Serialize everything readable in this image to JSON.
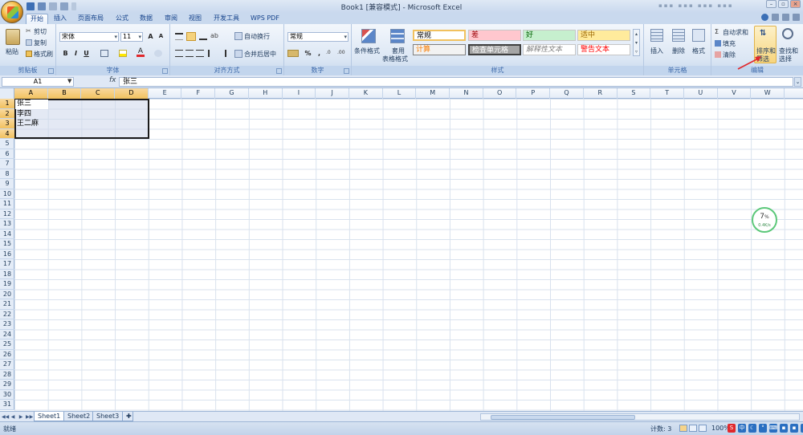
{
  "window": {
    "title": "Book1  [兼容模式] - Microsoft Excel"
  },
  "tabs": [
    "开始",
    "插入",
    "页面布局",
    "公式",
    "数据",
    "审阅",
    "视图",
    "开发工具",
    "WPS PDF"
  ],
  "ribbon": {
    "clipboard": {
      "paste": "粘贴",
      "cut": "剪切",
      "copy": "复制",
      "format_painter": "格式刷",
      "label": "剪贴板"
    },
    "font": {
      "name": "宋体",
      "size": "11",
      "bold": "B",
      "italic": "I",
      "underline": "U",
      "label": "字体"
    },
    "alignment": {
      "wrap": "自动换行",
      "merge": "合并后居中",
      "label": "对齐方式"
    },
    "number": {
      "format": "常规",
      "percent": "%",
      "comma": ",",
      "label": "数字"
    },
    "styles": {
      "conditional": "条件格式",
      "table": "套用",
      "table2": "表格格式",
      "normal": "常规",
      "bad": "差",
      "good": "好",
      "neutral": "适中",
      "calc": "计算",
      "check": "检查单元格",
      "explain": "解释性文本",
      "warning": "警告文本",
      "label": "样式"
    },
    "cells": {
      "insert": "插入",
      "delete": "删除",
      "format": "格式",
      "label": "单元格"
    },
    "editing": {
      "autosum": "自动求和",
      "fill": "填充",
      "clear": "清除",
      "sort": "排序和",
      "sort2": "筛选",
      "find": "查找和",
      "find2": "选择",
      "label": "编辑"
    }
  },
  "formula_bar": {
    "name_box": "A1",
    "fx": "fx",
    "content": "张三"
  },
  "grid": {
    "columns": [
      "A",
      "B",
      "C",
      "D",
      "E",
      "F",
      "G",
      "H",
      "I",
      "J",
      "K",
      "L",
      "M",
      "N",
      "O",
      "P",
      "Q",
      "R",
      "S",
      "T",
      "U",
      "V",
      "W"
    ],
    "rows": [
      "1",
      "2",
      "3",
      "4",
      "5",
      "6",
      "7",
      "8",
      "9",
      "10",
      "11",
      "12",
      "13",
      "14",
      "15",
      "16",
      "17",
      "18",
      "19",
      "20",
      "21",
      "22",
      "23",
      "24",
      "25",
      "26",
      "27",
      "28",
      "29",
      "30",
      "31"
    ],
    "cells": {
      "A1": "张三",
      "A2": "李四",
      "A3": "王二麻"
    }
  },
  "indicator": {
    "percent": "7",
    "unit": "%",
    "speed": "0.4K/s"
  },
  "sheets": [
    "Sheet1",
    "Sheet2",
    "Sheet3"
  ],
  "status": {
    "ready": "就绪",
    "count": "计数: 3",
    "zoom": "100%"
  },
  "colors": {
    "accent": "#f1c15f",
    "ribbon": "#dbe6f4",
    "arrow": "#e0282c"
  }
}
